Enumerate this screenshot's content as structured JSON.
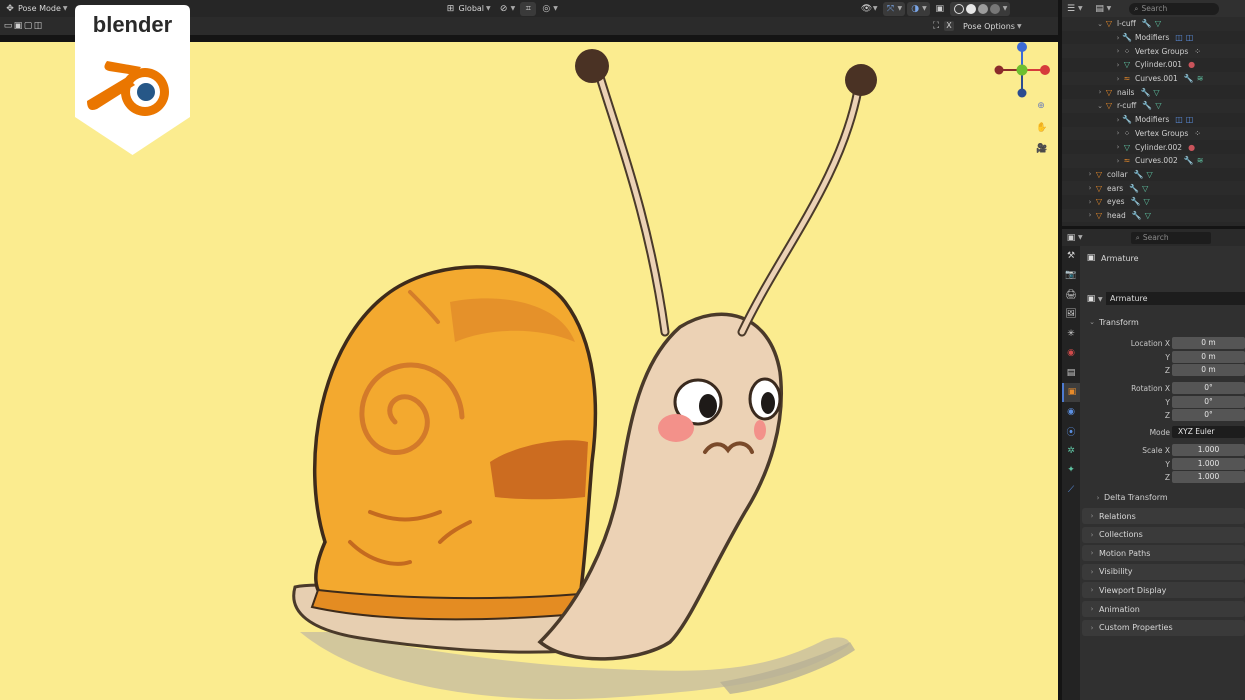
{
  "header": {
    "mode_label": "Pose Mode",
    "orientation_label": "Global",
    "pose_options_label": "Pose Options"
  },
  "logo": {
    "text": "blender"
  },
  "outliner": {
    "search_placeholder": "Search",
    "rows": [
      {
        "label": "l-cuff",
        "kind": "object",
        "indent": 1,
        "expanded": true
      },
      {
        "label": "Modifiers",
        "kind": "modifier",
        "indent": 2,
        "expanded": false
      },
      {
        "label": "Vertex Groups",
        "kind": "vgroup",
        "indent": 2,
        "expanded": false
      },
      {
        "label": "Cylinder.001",
        "kind": "mesh",
        "indent": 2,
        "expanded": false
      },
      {
        "label": "Curves.001",
        "kind": "curves",
        "indent": 2,
        "expanded": false
      },
      {
        "label": "nails",
        "kind": "object",
        "indent": 1,
        "expanded": false
      },
      {
        "label": "r-cuff",
        "kind": "object",
        "indent": 1,
        "expanded": true
      },
      {
        "label": "Modifiers",
        "kind": "modifier",
        "indent": 2,
        "expanded": false
      },
      {
        "label": "Vertex Groups",
        "kind": "vgroup",
        "indent": 2,
        "expanded": false
      },
      {
        "label": "Cylinder.002",
        "kind": "mesh",
        "indent": 2,
        "expanded": false
      },
      {
        "label": "Curves.002",
        "kind": "curves",
        "indent": 2,
        "expanded": false
      },
      {
        "label": "collar",
        "kind": "object",
        "indent": 0,
        "expanded": false
      },
      {
        "label": "ears",
        "kind": "object",
        "indent": 0,
        "expanded": false
      },
      {
        "label": "eyes",
        "kind": "object",
        "indent": 0,
        "expanded": false
      },
      {
        "label": "head",
        "kind": "object",
        "indent": 0,
        "expanded": false
      }
    ]
  },
  "properties": {
    "search_placeholder": "Search",
    "context_label": "Armature",
    "object_name": "Armature",
    "transform": {
      "title": "Transform",
      "location_x_label": "Location X",
      "location_x": "0 m",
      "location_y_label": "Y",
      "location_y": "0 m",
      "location_z_label": "Z",
      "location_z": "0 m",
      "rotation_x_label": "Rotation X",
      "rotation_x": "0°",
      "rotation_y_label": "Y",
      "rotation_y": "0°",
      "rotation_z_label": "Z",
      "rotation_z": "0°",
      "mode_label": "Mode",
      "mode_value": "XYZ Euler",
      "scale_x_label": "Scale X",
      "scale_x": "1.000",
      "scale_y_label": "Y",
      "scale_y": "1.000",
      "scale_z_label": "Z",
      "scale_z": "1.000",
      "delta_label": "Delta Transform"
    },
    "panels": [
      "Relations",
      "Collections",
      "Motion Paths",
      "Visibility",
      "Viewport Display",
      "Animation",
      "Custom Properties"
    ]
  },
  "colors": {
    "viewport_bg": "#fbec8f",
    "object_orange": "#e78a2a",
    "mesh_green": "#5fc4a3",
    "active_blue": "#4d7bd1"
  }
}
